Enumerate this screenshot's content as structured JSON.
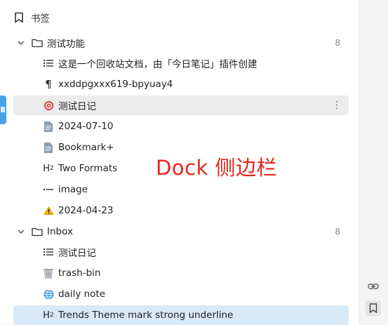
{
  "panel": {
    "title": "书签"
  },
  "groups": [
    {
      "name": "测试功能",
      "count": "8",
      "items": [
        {
          "label": "这是一个回收站文档，由「今日笔记」插件创建",
          "icon": "list-icon"
        },
        {
          "label": "xxddpgxxx619-bpyuay4",
          "icon": "paragraph-icon"
        },
        {
          "label": "测试日记",
          "icon": "target-emoji-icon"
        },
        {
          "label": "2024-07-10",
          "icon": "document-icon"
        },
        {
          "label": "Bookmark+",
          "icon": "document-icon"
        },
        {
          "label": "Two Formats",
          "icon": "heading2-icon"
        },
        {
          "label": "image",
          "icon": "dash-icon"
        },
        {
          "label": "2024-04-23",
          "icon": "warning-emoji-icon"
        }
      ]
    },
    {
      "name": "Inbox",
      "count": "8",
      "items": [
        {
          "label": "测试日记",
          "icon": "list-icon"
        },
        {
          "label": "trash-bin",
          "icon": "trash-emoji-icon"
        },
        {
          "label": "daily note",
          "icon": "globe-emoji-icon"
        },
        {
          "label": "Trends Theme mark strong underline",
          "icon": "heading2-icon"
        }
      ]
    }
  ],
  "overlay": {
    "text": "Dock 侧边栏"
  },
  "colors": {
    "accent": "#4aa3e8",
    "selected": "#d9e9f8",
    "hover": "#ececec",
    "overlay_text": "#e5261b"
  }
}
